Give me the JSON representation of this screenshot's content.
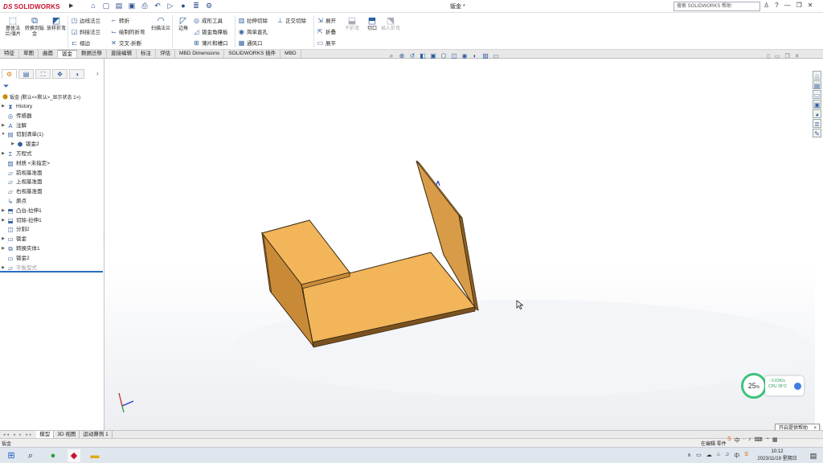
{
  "app": {
    "logo_text": "SOLIDWORKS",
    "logo_prefix": "DS",
    "doc_title": "钣金 *",
    "search_placeholder": "搜索 SOLIDWORKS 帮助",
    "title_icons": [
      "search-icon",
      "user-icon",
      "help-icon",
      "minimize-icon",
      "restore-icon",
      "close-icon"
    ]
  },
  "ribbon": {
    "big_buttons": [
      {
        "label": "基体法兰/薄片",
        "icon": "base-flange-icon"
      },
      {
        "label": "转换到钣金",
        "icon": "convert-sheetmetal-icon"
      },
      {
        "label": "放样折弯",
        "icon": "lofted-bend-icon"
      }
    ],
    "small_buttons": [
      {
        "label": "边线法兰",
        "icon": "edge-flange-icon"
      },
      {
        "label": "斜接法兰",
        "icon": "miter-flange-icon"
      },
      {
        "label": "褶边",
        "icon": "hem-icon"
      },
      {
        "label": "转折",
        "icon": "jog-icon"
      },
      {
        "label": "绘制的折弯",
        "icon": "sketched-bend-icon"
      },
      {
        "label": "交叉-折断",
        "icon": "cross-break-icon"
      },
      {
        "label": "成形工具",
        "icon": "forming-tool-icon"
      },
      {
        "label": "钣金角撑板",
        "icon": "gusset-icon"
      },
      {
        "label": "薄片和槽口",
        "icon": "tab-slot-icon"
      },
      {
        "label": "拉伸切除",
        "icon": "extruded-cut-icon"
      },
      {
        "label": "简单直孔",
        "icon": "simple-hole-icon"
      },
      {
        "label": "通风口",
        "icon": "vent-icon"
      },
      {
        "label": "正交切除",
        "icon": "normal-cut-icon"
      },
      {
        "label": "展开",
        "icon": "unfold-icon"
      },
      {
        "label": "折叠",
        "icon": "fold-icon"
      },
      {
        "label": "展平",
        "icon": "flatten-icon"
      }
    ],
    "mid_buttons": [
      {
        "label": "边角",
        "icon": "corner-icon"
      },
      {
        "label": "扫描法兰",
        "icon": "swept-flange-icon"
      }
    ],
    "right_buttons": [
      {
        "label": "不折弯",
        "icon": "no-bends-icon"
      },
      {
        "label": "切口",
        "icon": "rip-icon"
      },
      {
        "label": "插入折弯",
        "icon": "insert-bends-icon"
      }
    ]
  },
  "command_tabs": [
    "特征",
    "草图",
    "曲面",
    "钣金",
    "数据迁移",
    "直接编辑",
    "标注",
    "评估",
    "MBD Dimensions",
    "SOLIDWORKS 插件",
    "MBD"
  ],
  "active_tab": "钣金",
  "feature_manager": {
    "root_label": "钣金 (默认<<默认>_显示状态 1>)",
    "items": [
      {
        "label": "History",
        "icon": "history-icon",
        "expandable": true
      },
      {
        "label": "传感器",
        "icon": "sensor-icon",
        "expandable": false
      },
      {
        "label": "注解",
        "icon": "annotation-icon",
        "expandable": true
      },
      {
        "label": "切割清单(1)",
        "icon": "cutlist-icon",
        "expandable": true,
        "expanded": true
      },
      {
        "label": "钣金2",
        "icon": "body-icon",
        "expandable": true,
        "indent": 1
      },
      {
        "label": "方程式",
        "icon": "equation-icon",
        "expandable": true
      },
      {
        "label": "材质 <未指定>",
        "icon": "material-icon",
        "expandable": false
      },
      {
        "label": "前视基准面",
        "icon": "plane-icon",
        "expandable": false
      },
      {
        "label": "上视基准面",
        "icon": "plane-icon",
        "expandable": false
      },
      {
        "label": "右视基准面",
        "icon": "plane-icon",
        "expandable": false
      },
      {
        "label": "原点",
        "icon": "origin-icon",
        "expandable": false
      },
      {
        "label": "凸台-拉伸1",
        "icon": "extrude-icon",
        "expandable": true
      },
      {
        "label": "切除-拉伸1",
        "icon": "cut-extrude-icon",
        "expandable": true
      },
      {
        "label": "分割2",
        "icon": "split-icon",
        "expandable": false
      },
      {
        "label": "钣金",
        "icon": "sheetmetal-icon",
        "expandable": true
      },
      {
        "label": "转换实体1",
        "icon": "convert-icon",
        "expandable": true
      },
      {
        "label": "钣金2",
        "icon": "sheetmetal-icon",
        "expandable": false
      },
      {
        "label": "平板型式",
        "icon": "flat-pattern-icon",
        "expandable": true,
        "dim": true
      }
    ]
  },
  "bottom_tabs": [
    "模型",
    "3D 视图",
    "运动算例 1"
  ],
  "status": {
    "left": "钣金",
    "right": "在编辑 零件",
    "tooltip": "开启提供帮助",
    "tooltip_close": "×"
  },
  "perf_widget": {
    "percent_value": "25",
    "percent_sign": "%",
    "net": "↑ 0.02K/s",
    "cpu": "CPU 35°C"
  },
  "taskbar": {
    "time": "10:12",
    "date": "2023/11/19 星期日",
    "ime": "中",
    "icons": [
      "windows-start-icon",
      "search-icon",
      "app-green-icon",
      "solidworks-icon",
      "file-explorer-icon"
    ]
  },
  "colors": {
    "part_face_top": "#F2B55A",
    "part_face_side": "#C98A38",
    "part_edge": "#3A2A12",
    "tab_active_bg": "#FFFFFF",
    "selection_rule": "#2B6CC4"
  }
}
